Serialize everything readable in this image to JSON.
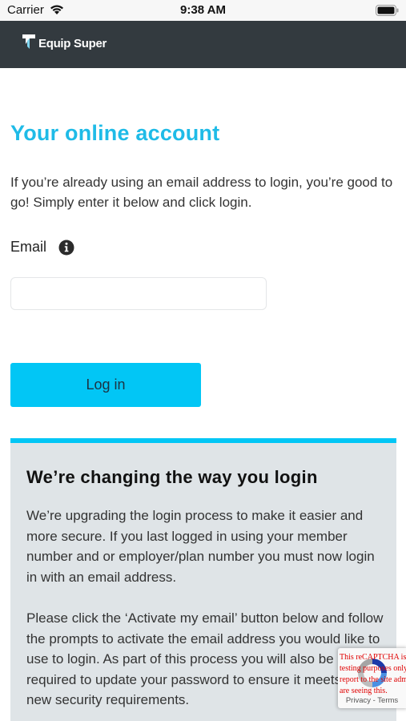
{
  "status_bar": {
    "carrier": "Carrier",
    "time": "9:38 AM"
  },
  "header": {
    "logo_text": "Equip Super",
    "background": "#333a3f"
  },
  "main": {
    "title": "Your online account",
    "intro": "If you’re already using an email address to login, you’re good to go! Simply enter it below and click login.",
    "email_label": "Email",
    "email_value": "",
    "email_placeholder": "",
    "login_label": "Log in"
  },
  "notice": {
    "title": "We’re changing the way you login",
    "paragraph1": "We’re upgrading the login process to make it easier and more secure. If you last logged in using your member number and or employer/plan number you must now login in with an email address.",
    "paragraph2": "Please click the ‘Activate my email’ button below and follow the prompts to activate the email address you would like to use to login. As part of this process you will also be required to update your password to ensure it meets our new security requirements."
  },
  "recaptcha": {
    "error_text": "This reCAPTCHA is for testing purposes only. Please report to the site admin if you are seeing this.",
    "privacy_label": "Privacy",
    "separator": " - ",
    "terms_label": "Terms"
  },
  "colors": {
    "accent": "#1fbbe7",
    "button": "#02c6f5",
    "panel": "#dfe4e7"
  }
}
